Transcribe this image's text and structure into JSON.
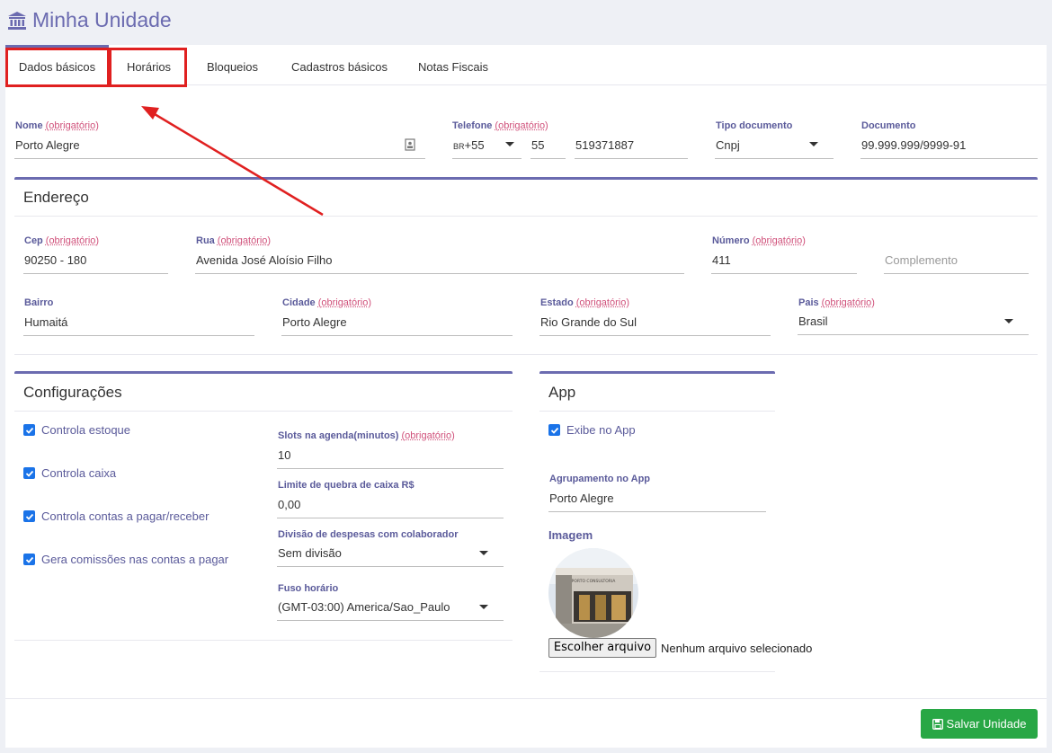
{
  "page": {
    "title": "Minha Unidade"
  },
  "tabs": [
    {
      "label": "Dados básicos"
    },
    {
      "label": "Horários"
    },
    {
      "label": "Bloqueios"
    },
    {
      "label": "Cadastros básicos"
    },
    {
      "label": "Notas Fiscais"
    }
  ],
  "required_tag": "(obrigatório)",
  "basic": {
    "nome_label": "Nome",
    "nome_value": "Porto Alegre",
    "telefone_label": "Telefone",
    "telefone_country": "BR",
    "telefone_code": "+55",
    "telefone_ddd": "55",
    "telefone_number": "519371887",
    "tipo_doc_label": "Tipo documento",
    "tipo_doc_value": "Cnpj",
    "documento_label": "Documento",
    "documento_value": "99.999.999/9999-91"
  },
  "endereco": {
    "title": "Endereço",
    "cep_label": "Cep",
    "cep_value": "90250 - 180",
    "rua_label": "Rua",
    "rua_value": "Avenida José Aloísio Filho",
    "numero_label": "Número",
    "numero_value": "411",
    "complemento_placeholder": "Complemento",
    "bairro_label": "Bairro",
    "bairro_value": "Humaitá",
    "cidade_label": "Cidade",
    "cidade_value": "Porto Alegre",
    "estado_label": "Estado",
    "estado_value": "Rio Grande do Sul",
    "pais_label": "Pais",
    "pais_value": "Brasil"
  },
  "config": {
    "title": "Configurações",
    "checks": [
      "Controla estoque",
      "Controla caixa",
      "Controla contas a pagar/receber",
      "Gera comissões nas contas a pagar"
    ],
    "slots_label": "Slots na agenda(minutos)",
    "slots_value": "10",
    "limite_label": "Limite de quebra de caixa R$",
    "limite_value": "0,00",
    "divisao_label": "Divisão de despesas com colaborador",
    "divisao_value": "Sem divisão",
    "fuso_label": "Fuso horário",
    "fuso_value": "(GMT-03:00) America/Sao_Paulo"
  },
  "app": {
    "title": "App",
    "exibe_label": "Exibe no App",
    "agrupamento_label": "Agrupamento no App",
    "agrupamento_value": "Porto Alegre",
    "imagem_label": "Imagem",
    "image_caption": "PORTO CONSULTORIA",
    "file_button": "Escolher arquivo",
    "file_status": "Nenhum arquivo selecionado"
  },
  "actions": {
    "save_label": "Salvar Unidade"
  },
  "colors": {
    "accent": "#6b6bb0",
    "required": "#d0507a",
    "save": "#28a745",
    "checkbox": "#1a73e8",
    "annotation": "#e02020"
  },
  "icons": [
    "bank-icon",
    "contact-card-icon",
    "check-icon",
    "save-icon",
    "chevron-down-icon",
    "annotation-arrow"
  ]
}
